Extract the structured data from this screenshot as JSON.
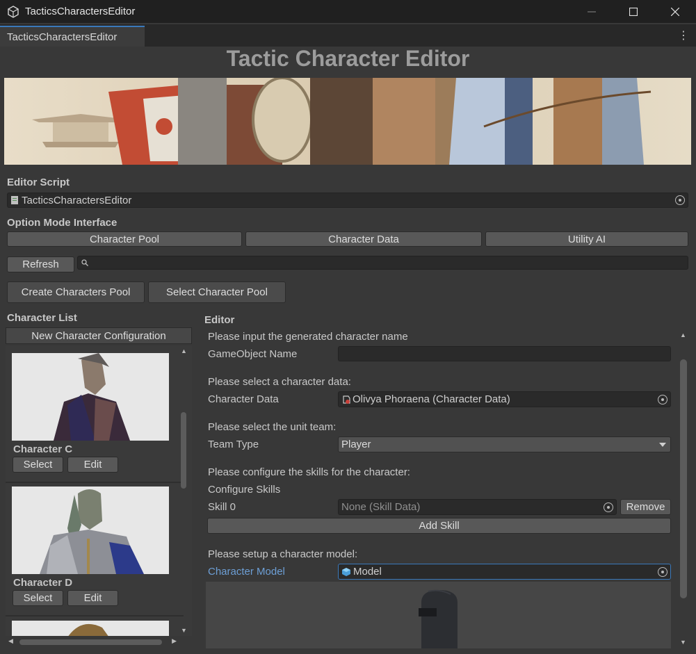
{
  "window": {
    "title": "TacticsCharactersEditor"
  },
  "tab": {
    "label": "TacticsCharactersEditor"
  },
  "header": {
    "title": "Tactic Character Editor"
  },
  "editor_script": {
    "label": "Editor Script",
    "value": "TacticsCharactersEditor"
  },
  "option_mode": {
    "label": "Option Mode Interface",
    "buttons": [
      "Character Pool",
      "Character Data",
      "Utility AI"
    ]
  },
  "toolbar": {
    "refresh": "Refresh",
    "create_pool": "Create Characters Pool",
    "select_pool": "Select Character Pool"
  },
  "character_list": {
    "label": "Character List",
    "new_config": "New Character Configuration",
    "items": [
      {
        "name": "Character C",
        "select": "Select",
        "edit": "Edit"
      },
      {
        "name": "Character D",
        "select": "Select",
        "edit": "Edit"
      }
    ]
  },
  "editor": {
    "label": "Editor",
    "name_prompt": "Please input the generated character name",
    "gameobject_label": "GameObject Name",
    "gameobject_value": "",
    "data_prompt": "Please select a character data:",
    "data_label": "Character Data",
    "data_value": "Olivya Phoraena (Character Data)",
    "team_prompt": "Please select the unit team:",
    "team_label": "Team Type",
    "team_value": "Player",
    "skills_prompt": "Please configure the skills for the character:",
    "skills_title": "Configure Skills",
    "skill_label": "Skill 0",
    "skill_value": "None (Skill Data)",
    "remove": "Remove",
    "add_skill": "Add Skill",
    "model_prompt": "Please setup a character model:",
    "model_label": "Character Model",
    "model_value": "Model"
  },
  "colors": {
    "accent": "#3a79bb",
    "model_label": "#6d9fd6"
  }
}
